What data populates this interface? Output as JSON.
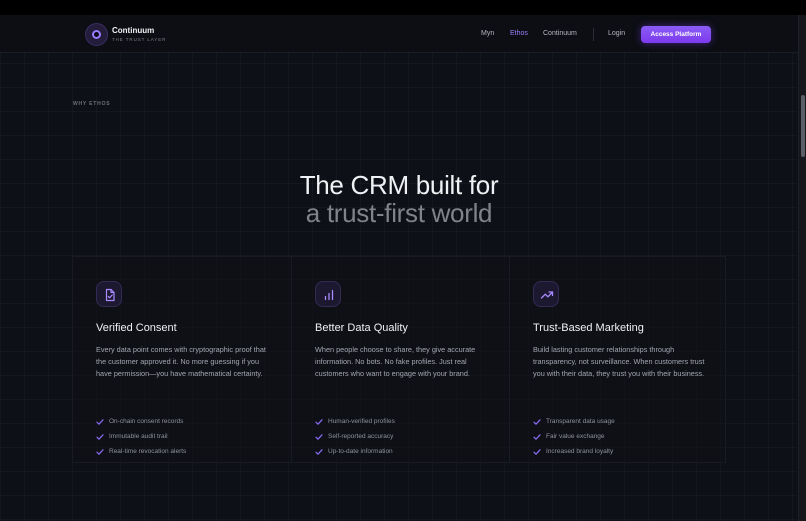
{
  "brand": {
    "name": "Continuum",
    "tagline": "THE TRUST LAYER",
    "logo_icon": "ring-logo-icon",
    "accent_color": "#8b5cf6"
  },
  "nav": {
    "links": [
      "Myn",
      "Ethos",
      "Continuum"
    ],
    "active_link": "Ethos",
    "login": "Login",
    "cta": "Access Platform"
  },
  "hero": {
    "eyebrow": "WHY ETHOS",
    "headline_line1": "The CRM built for",
    "headline_line2": "a trust-first world"
  },
  "cards": [
    {
      "icon": "document-check-icon",
      "title": "Verified Consent",
      "description": "Every data point comes with cryptographic proof that the customer approved it. No more guessing if you have permission—you have mathematical certainty.",
      "features": [
        "On-chain consent records",
        "Immutable audit trail",
        "Real-time revocation alerts"
      ]
    },
    {
      "icon": "bar-chart-icon",
      "title": "Better Data Quality",
      "description": "When people choose to share, they give accurate information. No bots. No fake profiles. Just real customers who want to engage with your brand.",
      "features": [
        "Human-verified profiles",
        "Self-reported accuracy",
        "Up-to-date information"
      ]
    },
    {
      "icon": "trending-up-icon",
      "title": "Trust-Based Marketing",
      "description": "Build lasting customer relationships through transparency, not surveillance. When customers trust you with their data, they trust you with their business.",
      "features": [
        "Transparent data usage",
        "Fair value exchange",
        "Increased brand loyalty"
      ]
    }
  ]
}
